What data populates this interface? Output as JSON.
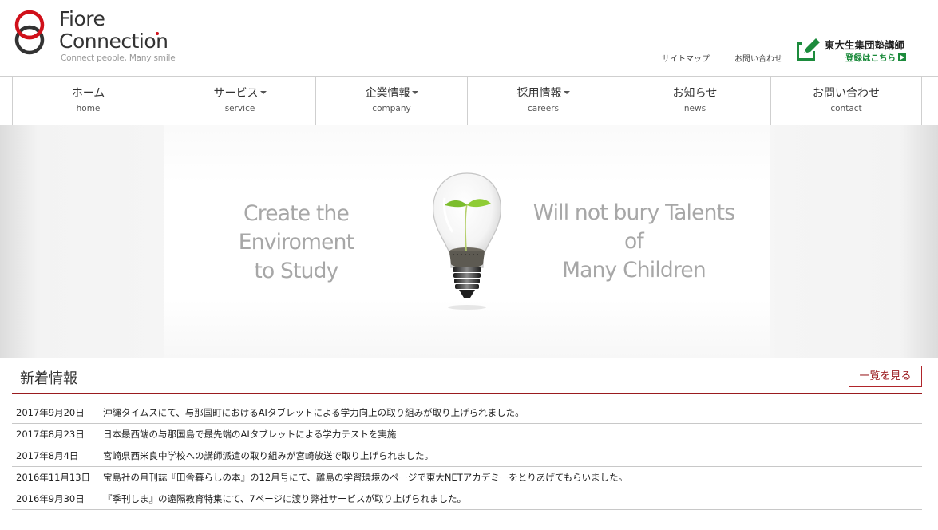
{
  "header": {
    "logo": {
      "name_line1": "Fiore",
      "name_line2": "Connection",
      "tagline": "Connect people, Many smile",
      "colors": {
        "red": "#d0101a",
        "dark": "#333333"
      }
    },
    "util_links": [
      {
        "label": "サイトマップ"
      },
      {
        "label": "お問い合わせ"
      }
    ],
    "tutor": {
      "title": "東大生集団塾講師",
      "sub": "登録はこちら",
      "icon": "pencil-edit-icon",
      "accent": "#1c8b3c"
    }
  },
  "nav": {
    "items": [
      {
        "jp": "ホーム",
        "en": "home",
        "dropdown": false
      },
      {
        "jp": "サービス",
        "en": "service",
        "dropdown": true
      },
      {
        "jp": "企業情報",
        "en": "company",
        "dropdown": true
      },
      {
        "jp": "採用情報",
        "en": "careers",
        "dropdown": true
      },
      {
        "jp": "お知らせ",
        "en": "news",
        "dropdown": false
      },
      {
        "jp": "お問い合わせ",
        "en": "contact",
        "dropdown": false
      }
    ]
  },
  "hero": {
    "left_line1": "Create the Enviroment",
    "left_line2": "to Study",
    "right_line1": "Will not bury Talents of",
    "right_line2": "Many Children",
    "image": "lightbulb-sprout-icon"
  },
  "news": {
    "title": "新着情報",
    "more_label": "一覧を見る",
    "accent": "#9a1b1f",
    "items": [
      {
        "date": "2017年9月20日",
        "text": "沖縄タイムスにて、与那国町におけるAIタブレットによる学力向上の取り組みが取り上げられました。"
      },
      {
        "date": "2017年8月23日",
        "text": "日本最西端の与那国島で最先端のAIタブレットによる学力テストを実施"
      },
      {
        "date": "2017年8月4日",
        "text": "宮崎県西米良中学校への講師派遣の取り組みが宮崎放送で取り上げられました。"
      },
      {
        "date": "2016年11月13日",
        "text": "宝島社の月刊誌『田舎暮らしの本』の12月号にて、離島の学習環境のページで東大NETアカデミーをとりあげてもらいました。"
      },
      {
        "date": "2016年9月30日",
        "text": "『季刊しま』の遠隔教育特集にて、7ページに渡り弊社サービスが取り上げられました。"
      }
    ]
  }
}
